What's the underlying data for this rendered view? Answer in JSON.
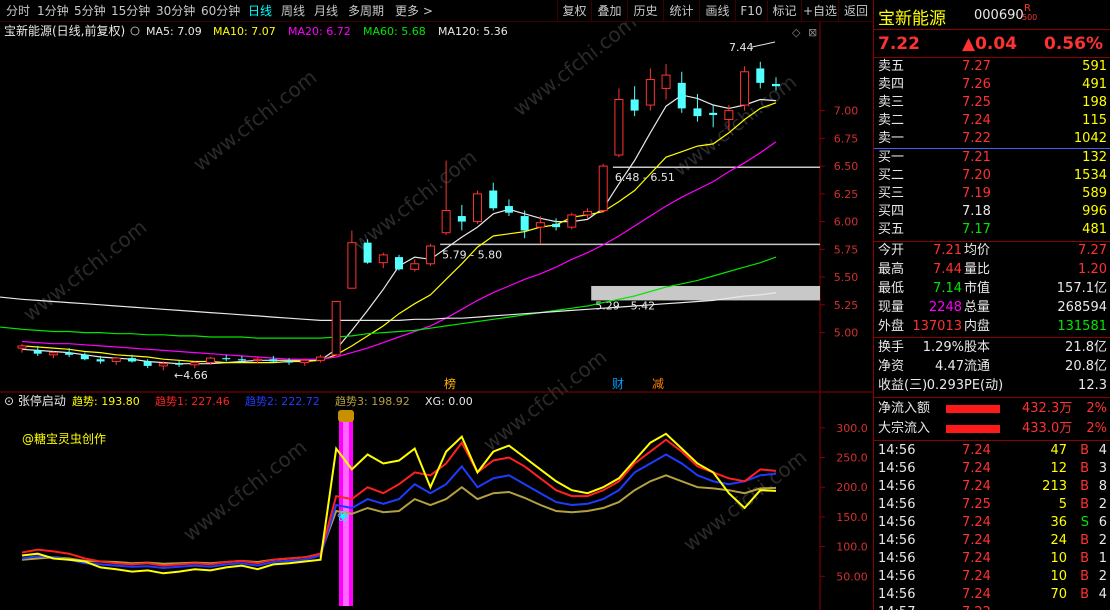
{
  "toolbar": {
    "left_items": [
      "分时",
      "1分钟",
      "5分钟",
      "15分钟",
      "30分钟",
      "60分钟",
      "日线",
      "周线",
      "月线",
      "多周期",
      "更多 >"
    ],
    "right_items": [
      "复权",
      "叠加",
      "历史",
      "统计",
      "画线",
      "F10",
      "标记",
      "+自选",
      "返回"
    ],
    "active": "日线"
  },
  "price_panel": {
    "title": "宝新能源(日线,前复权)",
    "ma": [
      {
        "label": "MA5: 7.09",
        "color": "#e8e8e8"
      },
      {
        "label": "MA10: 7.07",
        "color": "#ffff00"
      },
      {
        "label": "MA20: 6.72",
        "color": "#ff00ff"
      },
      {
        "label": "MA60: 5.68",
        "color": "#00e600"
      },
      {
        "label": "MA120: 5.36",
        "color": "#e8e8e8"
      }
    ],
    "y_ticks": [
      "7.00",
      "6.75",
      "6.50",
      "6.25",
      "6.00",
      "5.75",
      "5.50",
      "5.25",
      "5.00"
    ],
    "high_label": "7.44",
    "low_label": "4.66",
    "zones": [
      "6.48 - 6.51",
      "5.79 - 5.80",
      "5.29 - 5.42"
    ],
    "event_labels": [
      {
        "text": "榜",
        "color": "#ffb400"
      },
      {
        "text": "财",
        "color": "#00a0ff"
      },
      {
        "text": "减",
        "color": "#ff8000"
      }
    ],
    "watermark": "www.cfchi.com"
  },
  "indicator_panel": {
    "title": "张停启动",
    "values": [
      {
        "label": "趋势: 193.80",
        "color": "#ffff00"
      },
      {
        "label": "趋势1: 227.46",
        "color": "#ff2020"
      },
      {
        "label": "趋势2: 222.72",
        "color": "#1e3cff"
      },
      {
        "label": "趋势3: 198.92",
        "color": "#b4a040"
      },
      {
        "label": "XG: 0.00",
        "color": "#e8e8e8"
      }
    ],
    "credit": "@糖宝灵虫创作",
    "y_ticks": [
      "300.0",
      "250.0",
      "200.0",
      "150.0",
      "100.0",
      "50.00"
    ]
  },
  "chart_data": [
    {
      "type": "candlestick",
      "title": "宝新能源(日线,前复权)",
      "ylim": [
        4.6,
        7.6
      ],
      "ohlc": [
        [
          4.86,
          4.9,
          4.82,
          4.88
        ],
        [
          4.84,
          4.88,
          4.79,
          4.81
        ],
        [
          4.8,
          4.83,
          4.77,
          4.82
        ],
        [
          4.82,
          4.86,
          4.78,
          4.8
        ],
        [
          4.8,
          4.82,
          4.75,
          4.76
        ],
        [
          4.76,
          4.79,
          4.72,
          4.74
        ],
        [
          4.74,
          4.78,
          4.71,
          4.77
        ],
        [
          4.77,
          4.8,
          4.73,
          4.74
        ],
        [
          4.74,
          4.76,
          4.68,
          4.7
        ],
        [
          4.7,
          4.74,
          4.66,
          4.72
        ],
        [
          4.72,
          4.75,
          4.69,
          4.71
        ],
        [
          4.71,
          4.74,
          4.68,
          4.73
        ],
        [
          4.73,
          4.78,
          4.71,
          4.77
        ],
        [
          4.77,
          4.8,
          4.74,
          4.76
        ],
        [
          4.76,
          4.79,
          4.73,
          4.75
        ],
        [
          4.75,
          4.78,
          4.72,
          4.76
        ],
        [
          4.76,
          4.79,
          4.73,
          4.74
        ],
        [
          4.74,
          4.77,
          4.71,
          4.73
        ],
        [
          4.73,
          4.76,
          4.7,
          4.75
        ],
        [
          4.75,
          4.8,
          4.73,
          4.78
        ],
        [
          4.8,
          5.28,
          4.79,
          5.28
        ],
        [
          5.4,
          5.92,
          5.4,
          5.81
        ],
        [
          5.81,
          5.84,
          5.62,
          5.63
        ],
        [
          5.63,
          5.72,
          5.58,
          5.7
        ],
        [
          5.68,
          5.7,
          5.56,
          5.57
        ],
        [
          5.57,
          5.66,
          5.55,
          5.62
        ],
        [
          5.62,
          5.8,
          5.6,
          5.78
        ],
        [
          5.9,
          6.55,
          5.88,
          6.1
        ],
        [
          6.05,
          6.15,
          5.92,
          6.0
        ],
        [
          6.0,
          6.28,
          5.98,
          6.25
        ],
        [
          6.28,
          6.35,
          6.1,
          6.12
        ],
        [
          6.14,
          6.2,
          6.05,
          6.08
        ],
        [
          6.05,
          6.1,
          5.85,
          5.92
        ],
        [
          5.95,
          6.05,
          5.8,
          5.99
        ],
        [
          5.98,
          6.03,
          5.92,
          5.95
        ],
        [
          5.95,
          6.08,
          5.93,
          6.06
        ],
        [
          6.06,
          6.12,
          6.03,
          6.09
        ],
        [
          6.1,
          6.52,
          6.08,
          6.5
        ],
        [
          6.6,
          7.2,
          6.58,
          7.1
        ],
        [
          7.1,
          7.22,
          6.95,
          7.0
        ],
        [
          7.05,
          7.38,
          7.0,
          7.28
        ],
        [
          7.2,
          7.42,
          7.1,
          7.32
        ],
        [
          7.25,
          7.35,
          6.98,
          7.02
        ],
        [
          7.02,
          7.15,
          6.9,
          6.95
        ],
        [
          6.98,
          7.05,
          6.85,
          6.96
        ],
        [
          6.92,
          7.05,
          6.82,
          7.0
        ],
        [
          7.05,
          7.4,
          7.0,
          7.35
        ],
        [
          7.38,
          7.44,
          7.2,
          7.25
        ],
        [
          7.24,
          7.3,
          7.18,
          7.22
        ]
      ],
      "ma_series": [
        {
          "name": "MA5",
          "color": "#e8e8e8",
          "values": [
            4.85,
            4.84,
            4.83,
            4.82,
            4.8,
            4.78,
            4.77,
            4.76,
            4.74,
            4.73,
            4.72,
            4.72,
            4.72,
            4.73,
            4.74,
            4.75,
            4.75,
            4.75,
            4.75,
            4.75,
            4.85,
            5.02,
            5.2,
            5.39,
            5.6,
            5.68,
            5.66,
            5.76,
            5.86,
            5.95,
            6.07,
            6.11,
            6.07,
            6.03,
            6.0,
            6.0,
            6.02,
            6.12,
            6.34,
            6.55,
            6.8,
            7.04,
            7.14,
            7.11,
            7.05,
            7.02,
            7.05,
            7.1,
            7.09
          ]
        },
        {
          "name": "MA10",
          "color": "#ffff00",
          "values": [
            4.88,
            4.87,
            4.86,
            4.85,
            4.83,
            4.82,
            4.8,
            4.79,
            4.78,
            4.76,
            4.75,
            4.74,
            4.74,
            4.73,
            4.73,
            4.73,
            4.73,
            4.74,
            4.74,
            4.75,
            4.8,
            4.88,
            4.97,
            5.06,
            5.17,
            5.26,
            5.34,
            5.48,
            5.62,
            5.77,
            5.87,
            5.89,
            5.91,
            5.95,
            5.97,
            6.04,
            6.06,
            6.09,
            6.18,
            6.28,
            6.43,
            6.58,
            6.63,
            6.68,
            6.7,
            6.8,
            6.92,
            7.02,
            7.07
          ]
        },
        {
          "name": "MA20",
          "color": "#ff00ff",
          "values": [
            4.92,
            4.91,
            4.9,
            4.9,
            4.89,
            4.88,
            4.87,
            4.86,
            4.85,
            4.84,
            4.83,
            4.82,
            4.81,
            4.8,
            4.79,
            4.78,
            4.77,
            4.76,
            4.76,
            4.76,
            4.78,
            4.82,
            4.86,
            4.91,
            4.96,
            5.01,
            5.06,
            5.13,
            5.21,
            5.29,
            5.36,
            5.42,
            5.48,
            5.53,
            5.59,
            5.66,
            5.72,
            5.79,
            5.87,
            5.96,
            6.05,
            6.14,
            6.22,
            6.29,
            6.36,
            6.45,
            6.53,
            6.62,
            6.72
          ]
        },
        {
          "name": "MA60",
          "color": "#00e600",
          "values": [
            5.03,
            5.02,
            5.01,
            5.01,
            5.0,
            5.0,
            4.99,
            4.99,
            4.98,
            4.98,
            4.97,
            4.97,
            4.96,
            4.96,
            4.96,
            4.95,
            4.95,
            4.95,
            4.95,
            4.95,
            4.96,
            4.97,
            4.99,
            5.0,
            5.01,
            5.02,
            5.04,
            5.06,
            5.08,
            5.1,
            5.12,
            5.14,
            5.16,
            5.18,
            5.2,
            5.22,
            5.24,
            5.27,
            5.3,
            5.33,
            5.37,
            5.41,
            5.44,
            5.47,
            5.51,
            5.55,
            5.59,
            5.63,
            5.68
          ]
        },
        {
          "name": "MA120",
          "color": "#e8e8e8",
          "values": [
            5.3,
            5.29,
            5.28,
            5.27,
            5.26,
            5.25,
            5.24,
            5.23,
            5.22,
            5.21,
            5.2,
            5.19,
            5.18,
            5.17,
            5.16,
            5.15,
            5.14,
            5.13,
            5.12,
            5.11,
            5.11,
            5.11,
            5.11,
            5.11,
            5.11,
            5.12,
            5.12,
            5.13,
            5.13,
            5.14,
            5.15,
            5.16,
            5.17,
            5.18,
            5.19,
            5.2,
            5.21,
            5.22,
            5.23,
            5.24,
            5.25,
            5.26,
            5.27,
            5.28,
            5.29,
            5.31,
            5.33,
            5.34,
            5.36
          ]
        }
      ]
    },
    {
      "type": "line",
      "title": "张停启动",
      "ylim": [
        0,
        330
      ],
      "series": [
        {
          "name": "趋势",
          "color": "#ffff00",
          "values": [
            85,
            88,
            80,
            78,
            75,
            65,
            62,
            58,
            60,
            55,
            58,
            62,
            60,
            65,
            68,
            62,
            70,
            72,
            75,
            78,
            265,
            230,
            255,
            240,
            245,
            265,
            200,
            260,
            285,
            225,
            260,
            270,
            250,
            230,
            210,
            195,
            190,
            200,
            215,
            245,
            275,
            290,
            265,
            240,
            225,
            190,
            165,
            195,
            193.8
          ]
        },
        {
          "name": "趋势1",
          "color": "#ff2020",
          "values": [
            90,
            95,
            92,
            88,
            80,
            75,
            72,
            70,
            72,
            68,
            70,
            72,
            70,
            74,
            76,
            72,
            78,
            80,
            82,
            88,
            185,
            180,
            200,
            190,
            205,
            225,
            220,
            240,
            275,
            225,
            245,
            250,
            235,
            215,
            195,
            185,
            185,
            195,
            210,
            240,
            260,
            280,
            260,
            235,
            225,
            215,
            210,
            230,
            227.46
          ]
        },
        {
          "name": "趋势2",
          "color": "#1e3cff",
          "values": [
            80,
            84,
            82,
            78,
            72,
            70,
            68,
            66,
            67,
            64,
            66,
            68,
            66,
            70,
            72,
            68,
            74,
            76,
            78,
            85,
            170,
            165,
            180,
            172,
            180,
            205,
            190,
            205,
            235,
            200,
            215,
            220,
            205,
            190,
            175,
            170,
            172,
            180,
            195,
            225,
            240,
            255,
            240,
            220,
            210,
            205,
            210,
            220,
            222.72
          ]
        },
        {
          "name": "趋势3",
          "color": "#b4a040",
          "values": [
            78,
            80,
            82,
            80,
            76,
            75,
            74,
            72,
            73,
            71,
            72,
            73,
            72,
            74,
            76,
            74,
            78,
            80,
            82,
            88,
            160,
            155,
            165,
            158,
            160,
            180,
            170,
            180,
            200,
            180,
            190,
            192,
            182,
            170,
            160,
            158,
            160,
            165,
            175,
            195,
            210,
            220,
            210,
            200,
            198,
            195,
            190,
            198,
            198.92
          ]
        }
      ]
    }
  ],
  "quote": {
    "name": "宝新能源",
    "code": "000690",
    "tag": "R",
    "tag2": "500",
    "price": "7.22",
    "change": "▲0.04",
    "pct": "0.56%",
    "asks": [
      {
        "label": "卖五",
        "price": "7.27",
        "vol": "591"
      },
      {
        "label": "卖四",
        "price": "7.26",
        "vol": "491"
      },
      {
        "label": "卖三",
        "price": "7.25",
        "vol": "198"
      },
      {
        "label": "卖二",
        "price": "7.24",
        "vol": "115"
      },
      {
        "label": "卖一",
        "price": "7.22",
        "vol": "1042"
      }
    ],
    "bids": [
      {
        "label": "买一",
        "price": "7.21",
        "vol": "132",
        "pc": "r"
      },
      {
        "label": "买二",
        "price": "7.20",
        "vol": "1534",
        "pc": "r"
      },
      {
        "label": "买三",
        "price": "7.19",
        "vol": "589",
        "pc": "r"
      },
      {
        "label": "买四",
        "price": "7.18",
        "vol": "996",
        "pc": "w"
      },
      {
        "label": "买五",
        "price": "7.17",
        "vol": "481",
        "pc": "g"
      }
    ],
    "stats": [
      {
        "l1": "今开",
        "v1": "7.21",
        "c1": "r",
        "l2": "均价",
        "v2": "7.27",
        "c2": "r"
      },
      {
        "l1": "最高",
        "v1": "7.44",
        "c1": "r",
        "l2": "量比",
        "v2": "1.20",
        "c2": "r"
      },
      {
        "l1": "最低",
        "v1": "7.14",
        "c1": "g",
        "l2": "市值",
        "v2": "157.1亿",
        "c2": "w"
      },
      {
        "l1": "现量",
        "v1": "2248",
        "c1": "m",
        "l2": "总量",
        "v2": "268594",
        "c2": "w"
      },
      {
        "l1": "外盘",
        "v1": "137013",
        "c1": "r",
        "l2": "内盘",
        "v2": "131581",
        "c2": "g"
      }
    ],
    "stats2": [
      {
        "l1": "换手",
        "v1": "1.29%",
        "l2": "股本",
        "v2": "21.8亿"
      },
      {
        "l1": "净资",
        "v1": "4.47",
        "l2": "流通",
        "v2": "20.8亿"
      },
      {
        "l1": "收益(三)",
        "v1": "0.293",
        "l2": "PE(动)",
        "v2": "12.3"
      }
    ],
    "flows": [
      {
        "label": "净流入额",
        "value": "432.3万",
        "pct": "2%"
      },
      {
        "label": "大宗流入",
        "value": "433.0万",
        "pct": "2%"
      }
    ],
    "ticks": [
      {
        "t": "14:56",
        "p": "7.24",
        "v": "47",
        "s": "B",
        "n": "4",
        "vc": "y"
      },
      {
        "t": "14:56",
        "p": "7.24",
        "v": "12",
        "s": "B",
        "n": "3",
        "vc": "y"
      },
      {
        "t": "14:56",
        "p": "7.24",
        "v": "213",
        "s": "B",
        "n": "8",
        "vc": "y"
      },
      {
        "t": "14:56",
        "p": "7.25",
        "v": "5",
        "s": "B",
        "n": "2",
        "vc": "y"
      },
      {
        "t": "14:56",
        "p": "7.24",
        "v": "36",
        "s": "S",
        "n": "6",
        "vc": "y"
      },
      {
        "t": "14:56",
        "p": "7.24",
        "v": "24",
        "s": "B",
        "n": "2",
        "vc": "y"
      },
      {
        "t": "14:56",
        "p": "7.24",
        "v": "10",
        "s": "B",
        "n": "1",
        "vc": "y"
      },
      {
        "t": "14:56",
        "p": "7.24",
        "v": "10",
        "s": "B",
        "n": "2",
        "vc": "y"
      },
      {
        "t": "14:56",
        "p": "7.24",
        "v": "70",
        "s": "B",
        "n": "4",
        "vc": "y"
      },
      {
        "t": "14:57",
        "p": "7.22",
        "v": "",
        "s": "",
        "n": "",
        "vc": "y"
      }
    ]
  }
}
